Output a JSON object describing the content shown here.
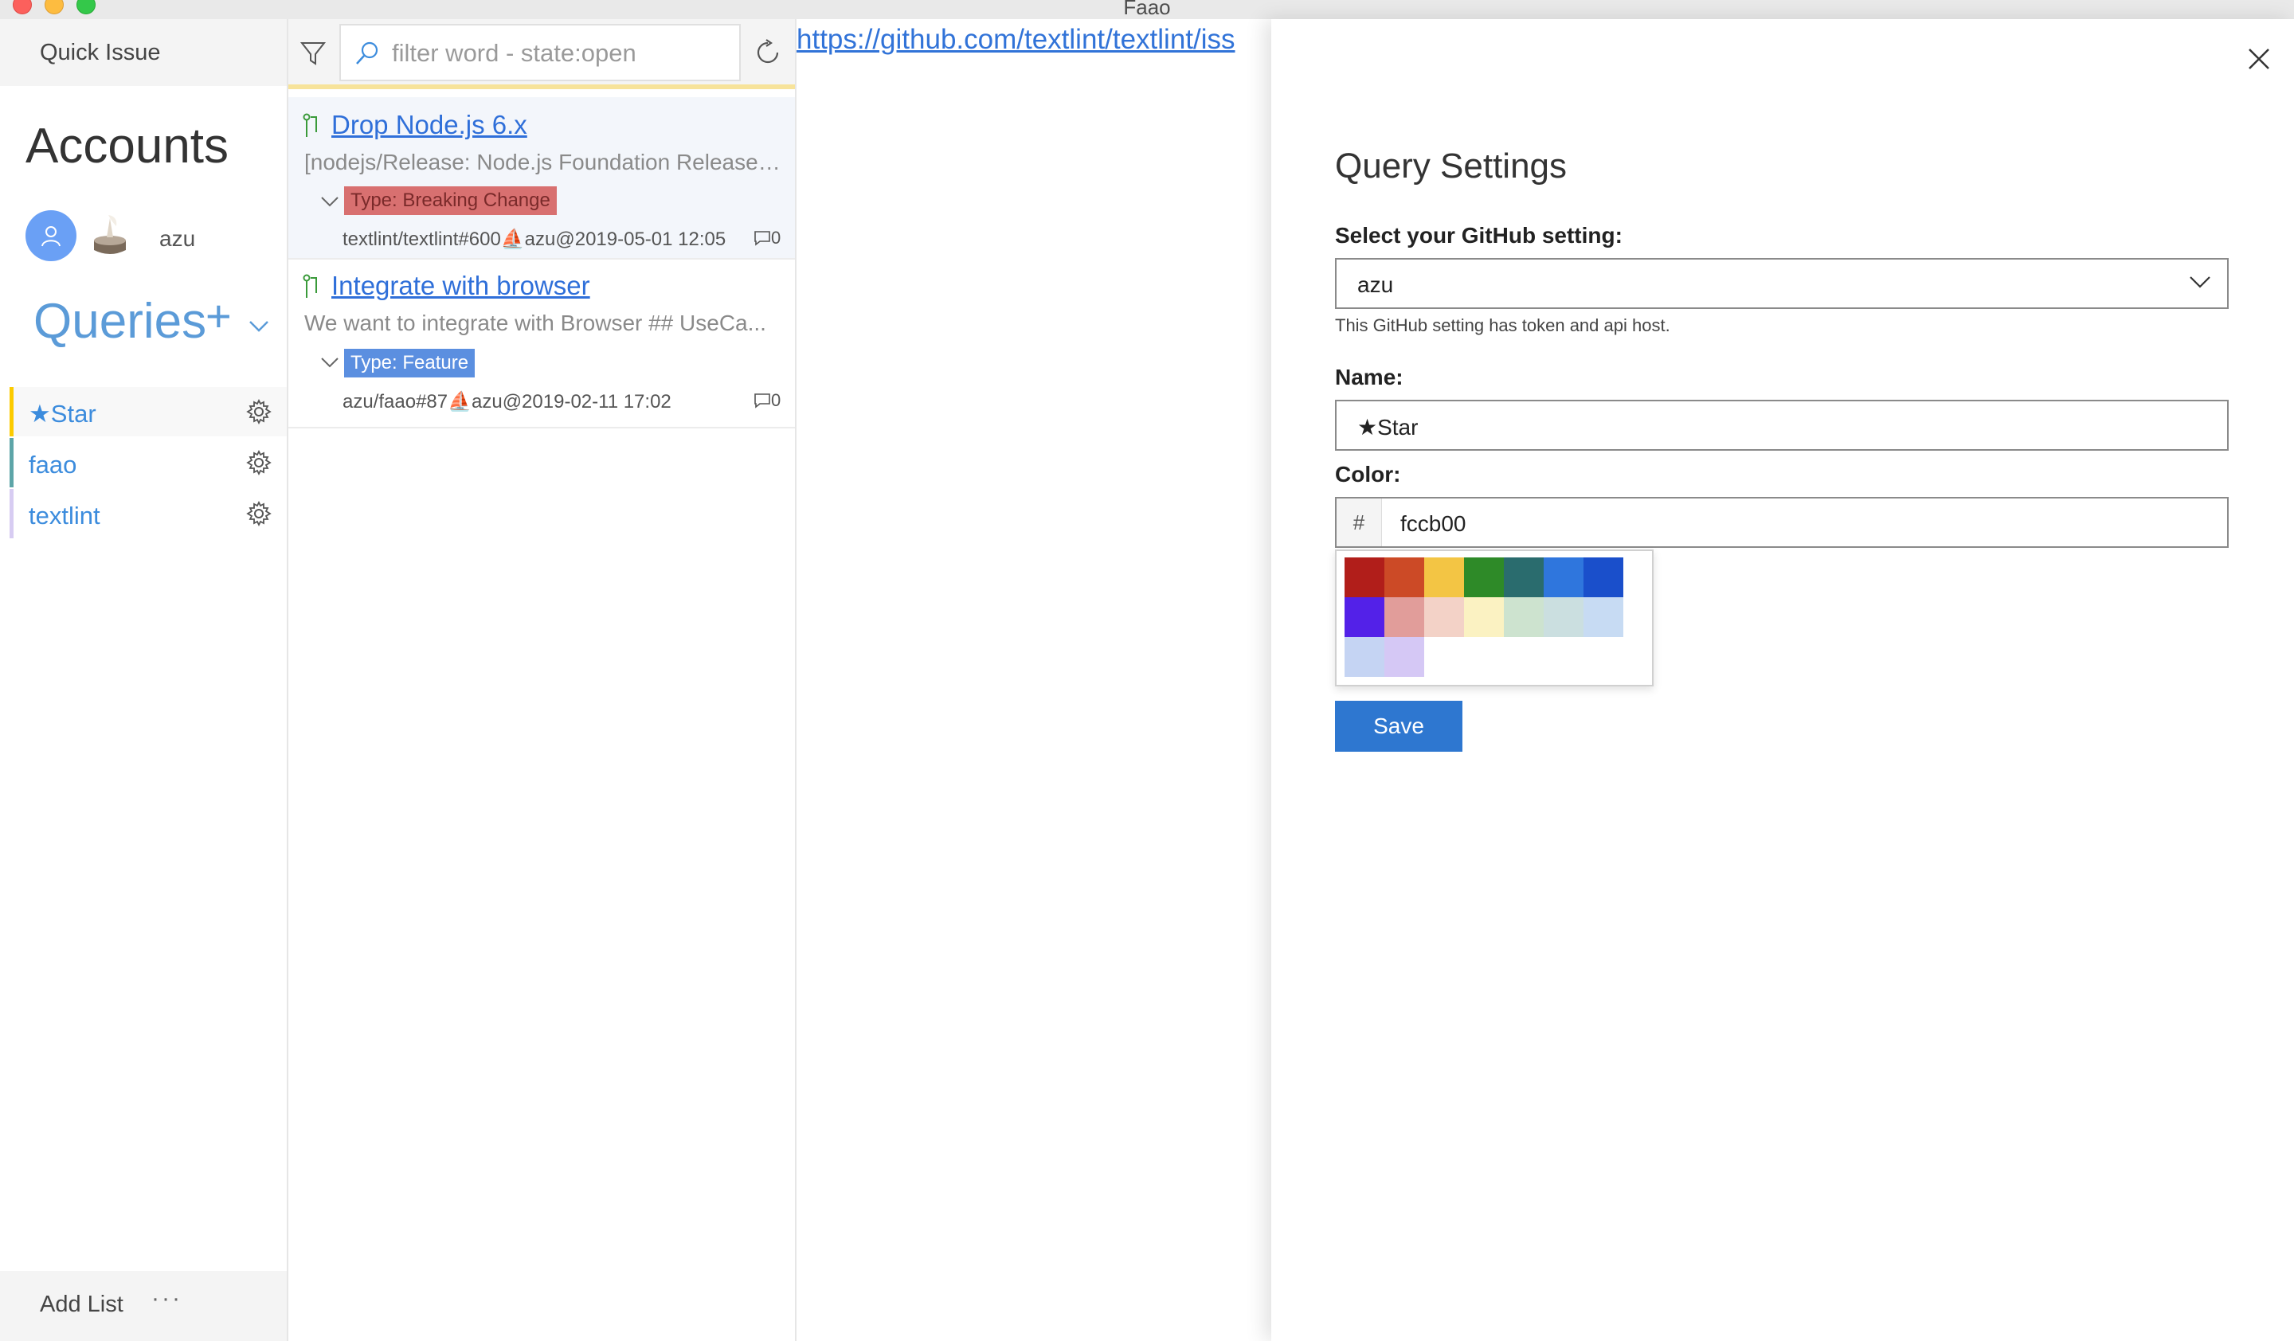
{
  "window": {
    "title": "Faao"
  },
  "sidebar": {
    "quick_issue": "Quick Issue",
    "accounts_title": "Accounts",
    "account_name": "azu",
    "queries_title": "Queries",
    "queries_add": "+",
    "queries": [
      {
        "label": "★Star",
        "color": "#fccb00"
      },
      {
        "label": "faao",
        "color": "#5da5a8"
      },
      {
        "label": "textlint",
        "color": "#d7ccf2"
      }
    ],
    "add_list": "Add List",
    "more": "···"
  },
  "list": {
    "search_placeholder": "filter word - state:open",
    "issues": [
      {
        "title": "Drop Node.js 6.x",
        "body": "[nodejs/Release: Node.js Foundation Release ...",
        "label": "Type: Breaking Change",
        "label_color": "#d87070",
        "meta": "textlint/textlint#600⛵azu@2019-05-01 12:05",
        "comments": "0"
      },
      {
        "title": "Integrate with browser",
        "body": "We want to integrate with Browser  ## UseCa...",
        "label": "Type: Feature",
        "label_color": "#5b8fe0",
        "meta": "azu/faao#87⛵azu@2019-02-11 17:02",
        "comments": "0"
      }
    ]
  },
  "web": {
    "url": "https://github.com/textlint/textlint/iss"
  },
  "settings": {
    "title": "Query Settings",
    "github_setting_label": "Select your GitHub setting:",
    "github_setting_value": "azu",
    "github_setting_hint": "This GitHub setting has token and api host.",
    "name_label": "Name:",
    "name_value": "★Star",
    "color_label": "Color:",
    "hash": "#",
    "color_value": "fccb00",
    "palette": [
      "#b11e1a",
      "#cc4a26",
      "#f3c544",
      "#2e8a28",
      "#2a6c6e",
      "#2f76dd",
      "#1a4fcb",
      "#5321e8",
      "#e19d9a",
      "#f3d2c7",
      "#fbf2c2",
      "#cde3cf",
      "#cbdfe0",
      "#c7dbf3",
      "#c5d4f3",
      "#d5c8f5"
    ],
    "save_label": "Save"
  }
}
